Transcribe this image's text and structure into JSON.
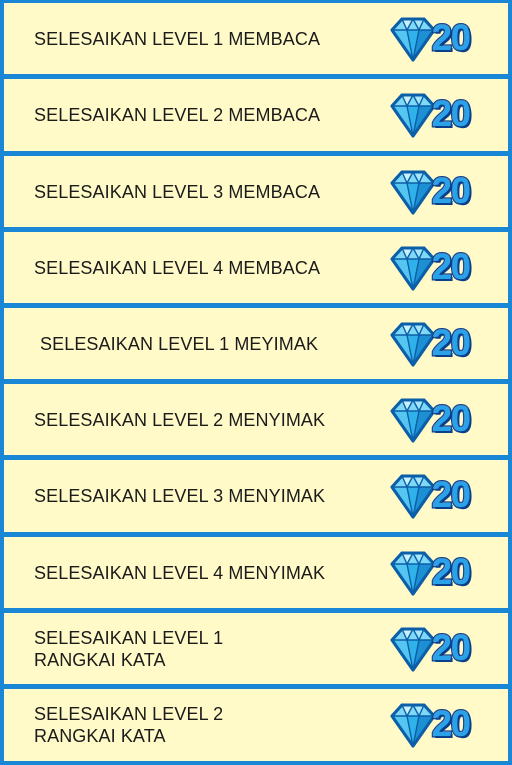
{
  "tasks": [
    {
      "label": "SELESAIKAN LEVEL 1 MEMBACA",
      "reward": "20"
    },
    {
      "label": "SELESAIKAN LEVEL 2 MEMBACA",
      "reward": "20"
    },
    {
      "label": "SELESAIKAN LEVEL 3 MEMBACA",
      "reward": "20"
    },
    {
      "label": "SELESAIKAN LEVEL 4 MEMBACA",
      "reward": "20"
    },
    {
      "label": "SELESAIKAN LEVEL 1 MEYIMAK",
      "reward": "20"
    },
    {
      "label": "SELESAIKAN LEVEL 2 MENYIMAK",
      "reward": "20"
    },
    {
      "label": "SELESAIKAN LEVEL 3 MENYIMAK",
      "reward": "20"
    },
    {
      "label": "SELESAIKAN LEVEL 4 MENYIMAK",
      "reward": "20"
    },
    {
      "label": "SELESAIKAN LEVEL 1\nRANGKAI KATA",
      "reward": "20"
    },
    {
      "label": "SELESAIKAN LEVEL 2\nRANGKAI KATA",
      "reward": "20"
    }
  ],
  "reward_icon": "diamond-icon",
  "colors": {
    "background": "#1a86d6",
    "row_fill": "#fffac8",
    "diamond_light": "#7fd9f6",
    "diamond_mid": "#2fb2ea",
    "diamond_dark": "#0b5fa8"
  }
}
